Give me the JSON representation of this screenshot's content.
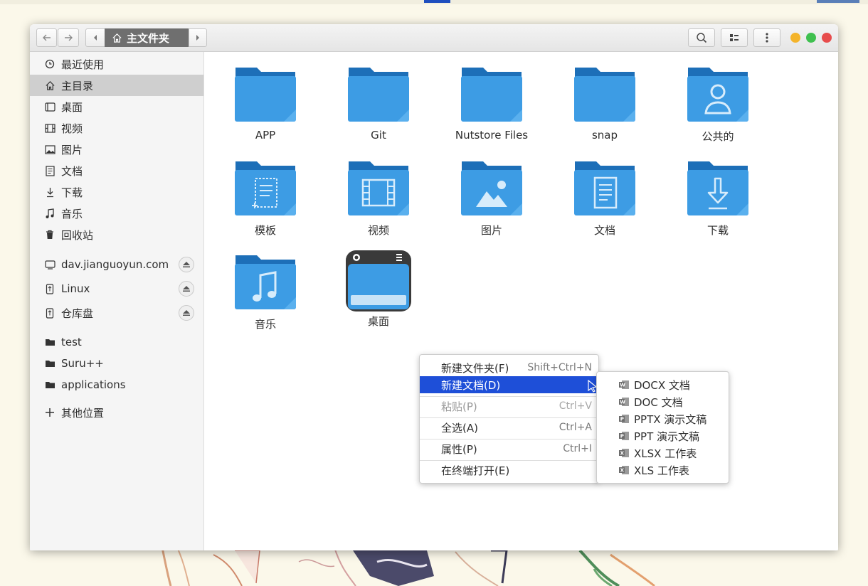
{
  "window": {
    "path_label": "主文件夹"
  },
  "sidebar": {
    "places": [
      {
        "label": "最近使用",
        "icon": "clock-icon"
      },
      {
        "label": "主目录",
        "icon": "home-icon",
        "active": true
      },
      {
        "label": "桌面",
        "icon": "desktop-icon"
      },
      {
        "label": "视频",
        "icon": "video-icon"
      },
      {
        "label": "图片",
        "icon": "picture-icon"
      },
      {
        "label": "文档",
        "icon": "document-icon"
      },
      {
        "label": "下载",
        "icon": "download-icon"
      },
      {
        "label": "音乐",
        "icon": "music-icon"
      },
      {
        "label": "回收站",
        "icon": "trash-icon"
      }
    ],
    "mounts": [
      {
        "label": "dav.jianguoyun.com",
        "icon": "network-drive-icon"
      },
      {
        "label": "Linux",
        "icon": "usb-drive-icon"
      },
      {
        "label": "仓库盘",
        "icon": "usb-drive-icon"
      }
    ],
    "bookmarks": [
      {
        "label": "test",
        "icon": "folder-icon"
      },
      {
        "label": "Suru++",
        "icon": "folder-icon"
      },
      {
        "label": "applications",
        "icon": "folder-icon"
      }
    ],
    "other_locations": "其他位置"
  },
  "files": [
    {
      "name": "APP",
      "icon": "folder-icon"
    },
    {
      "name": "Git",
      "icon": "folder-icon"
    },
    {
      "name": "Nutstore Files",
      "icon": "folder-icon"
    },
    {
      "name": "snap",
      "icon": "folder-icon"
    },
    {
      "name": "公共的",
      "icon": "public-folder-icon"
    },
    {
      "name": "模板",
      "icon": "templates-folder-icon"
    },
    {
      "name": "视频",
      "icon": "videos-folder-icon"
    },
    {
      "name": "图片",
      "icon": "pictures-folder-icon"
    },
    {
      "name": "文档",
      "icon": "documents-folder-icon"
    },
    {
      "name": "下载",
      "icon": "downloads-folder-icon"
    },
    {
      "name": "音乐",
      "icon": "music-folder-icon"
    },
    {
      "name": "桌面",
      "icon": "desktop-app-icon"
    }
  ],
  "context_menu": {
    "items": [
      {
        "label": "新建文件夹(F)",
        "shortcut": "Shift+Ctrl+N"
      },
      {
        "label": "新建文档(D)",
        "shortcut": "",
        "selected": true
      },
      {
        "label": "粘贴(P)",
        "shortcut": "Ctrl+V",
        "disabled": true
      },
      {
        "label": "全选(A)",
        "shortcut": "Ctrl+A"
      },
      {
        "label": "属性(P)",
        "shortcut": "Ctrl+I"
      },
      {
        "label": "在终端打开(E)",
        "shortcut": ""
      }
    ]
  },
  "submenu": {
    "items": [
      {
        "label": "DOCX 文档",
        "icon": "word-icon"
      },
      {
        "label": "DOC 文档",
        "icon": "word-icon"
      },
      {
        "label": "PPTX 演示文稿",
        "icon": "powerpoint-icon"
      },
      {
        "label": "PPT 演示文稿",
        "icon": "powerpoint-icon"
      },
      {
        "label": "XLSX 工作表",
        "icon": "excel-icon"
      },
      {
        "label": "XLS 工作表",
        "icon": "excel-icon"
      }
    ]
  },
  "colors": {
    "accent": "#1e4fd8",
    "folder_front": "#3d9ce4",
    "folder_back": "#1d6fb8",
    "close": "#e74c4c",
    "maximize": "#3fc04f",
    "minimize": "#f4b42b"
  }
}
